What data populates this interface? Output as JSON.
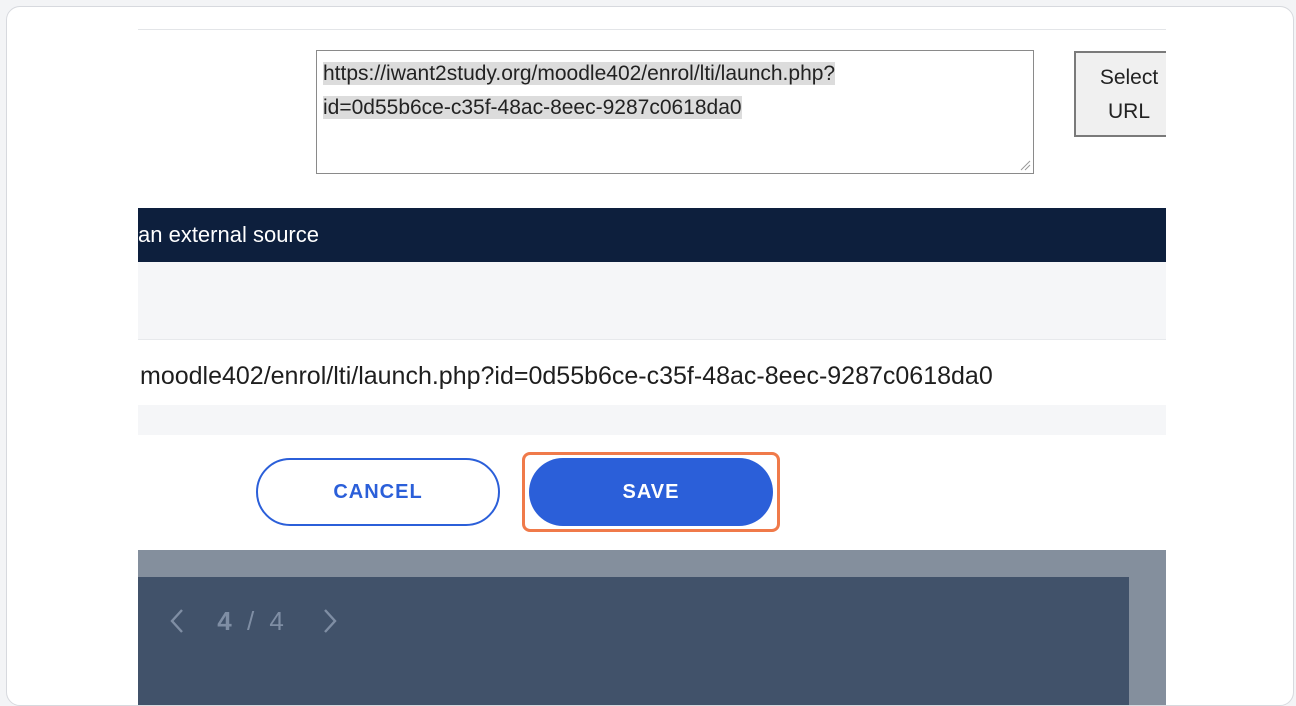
{
  "url_field": {
    "line1": "https://iwant2study.org/moodle402/enrol/lti/launch.php?",
    "line2": "id=0d55b6ce-c35f-48ac-8eec-9287c0618da0"
  },
  "select_url_button": {
    "line1": "Select",
    "line2": "URL"
  },
  "section_header": {
    "title": "an external source"
  },
  "launch_url_row": {
    "text": "moodle402/enrol/lti/launch.php?id=0d55b6ce-c35f-48ac-8eec-9287c0618da0"
  },
  "actions": {
    "cancel_label": "CANCEL",
    "save_label": "SAVE"
  },
  "pager": {
    "current": "4",
    "separator": "/",
    "total": "4"
  },
  "colors": {
    "header_bg": "#0d1f3d",
    "primary": "#2b5fd9",
    "highlight": "#f07a4a",
    "footer_bg": "#41526a"
  }
}
